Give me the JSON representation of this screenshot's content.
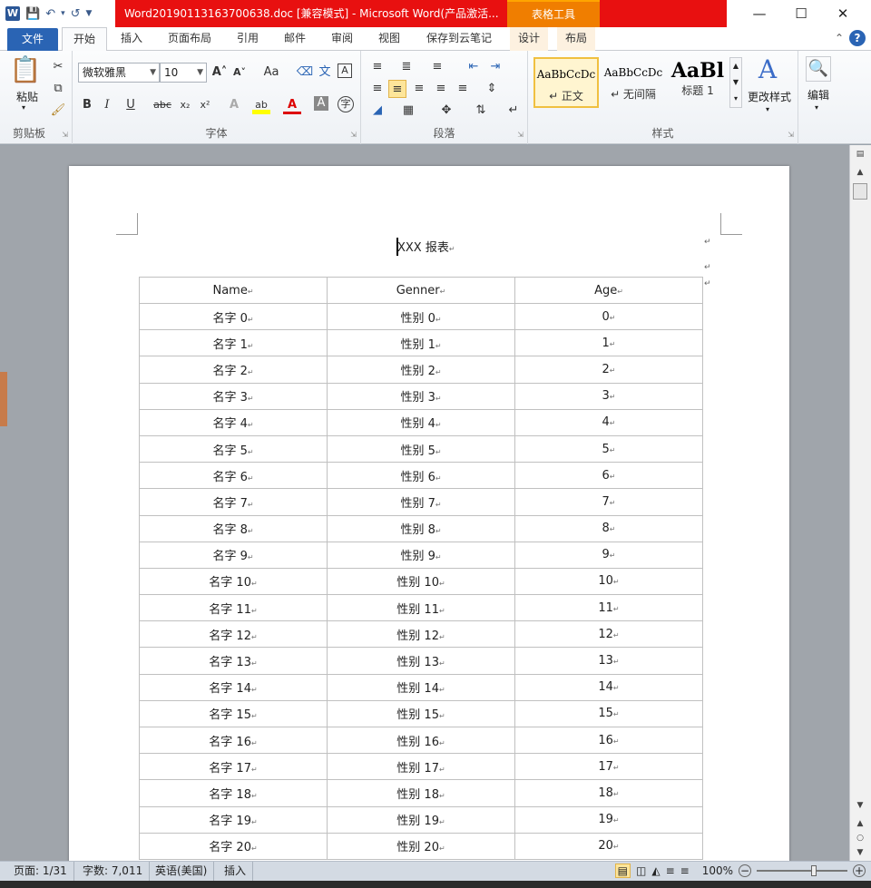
{
  "window": {
    "title": "Word20190113163700638.doc [兼容模式] - Microsoft Word(产品激活...",
    "context_tab": "表格工具",
    "app_icon": "W"
  },
  "tabs": [
    "文件",
    "开始",
    "插入",
    "页面布局",
    "引用",
    "邮件",
    "审阅",
    "视图",
    "保存到云笔记",
    "设计",
    "布局"
  ],
  "ribbon": {
    "clipboard": {
      "paste": "粘贴",
      "label": "剪贴板"
    },
    "font": {
      "name": "微软雅黑",
      "size": "10",
      "label": "字体",
      "aa": "Aa"
    },
    "paragraph": {
      "label": "段落"
    },
    "styles": {
      "label": "样式",
      "items": [
        {
          "preview": "AaBbCcDc",
          "name": "↵ 正文"
        },
        {
          "preview": "AaBbCcDc",
          "name": "↵ 无间隔"
        },
        {
          "preview": "AaBl",
          "name": "标题 1"
        }
      ],
      "change": "更改样式"
    },
    "editing": {
      "label": "编辑"
    }
  },
  "document": {
    "title": "XXX 报表",
    "table": {
      "headers": [
        "Name",
        "Genner",
        "Age"
      ],
      "rows": [
        [
          "名字 0",
          "性别 0",
          "0"
        ],
        [
          "名字 1",
          "性别 1",
          "1"
        ],
        [
          "名字 2",
          "性别 2",
          "2"
        ],
        [
          "名字 3",
          "性别 3",
          "3"
        ],
        [
          "名字 4",
          "性别 4",
          "4"
        ],
        [
          "名字 5",
          "性别 5",
          "5"
        ],
        [
          "名字 6",
          "性别 6",
          "6"
        ],
        [
          "名字 7",
          "性别 7",
          "7"
        ],
        [
          "名字 8",
          "性别 8",
          "8"
        ],
        [
          "名字 9",
          "性别 9",
          "9"
        ],
        [
          "名字 10",
          "性别 10",
          "10"
        ],
        [
          "名字 11",
          "性别 11",
          "11"
        ],
        [
          "名字 12",
          "性别 12",
          "12"
        ],
        [
          "名字 13",
          "性别 13",
          "13"
        ],
        [
          "名字 14",
          "性别 14",
          "14"
        ],
        [
          "名字 15",
          "性别 15",
          "15"
        ],
        [
          "名字 16",
          "性别 16",
          "16"
        ],
        [
          "名字 17",
          "性别 17",
          "17"
        ],
        [
          "名字 18",
          "性别 18",
          "18"
        ],
        [
          "名字 19",
          "性别 19",
          "19"
        ],
        [
          "名字 20",
          "性别 20",
          "20"
        ]
      ]
    }
  },
  "status": {
    "page": "页面: 1/31",
    "words": "字数: 7,011",
    "language": "英语(美国)",
    "mode": "插入",
    "zoom": "100%"
  }
}
